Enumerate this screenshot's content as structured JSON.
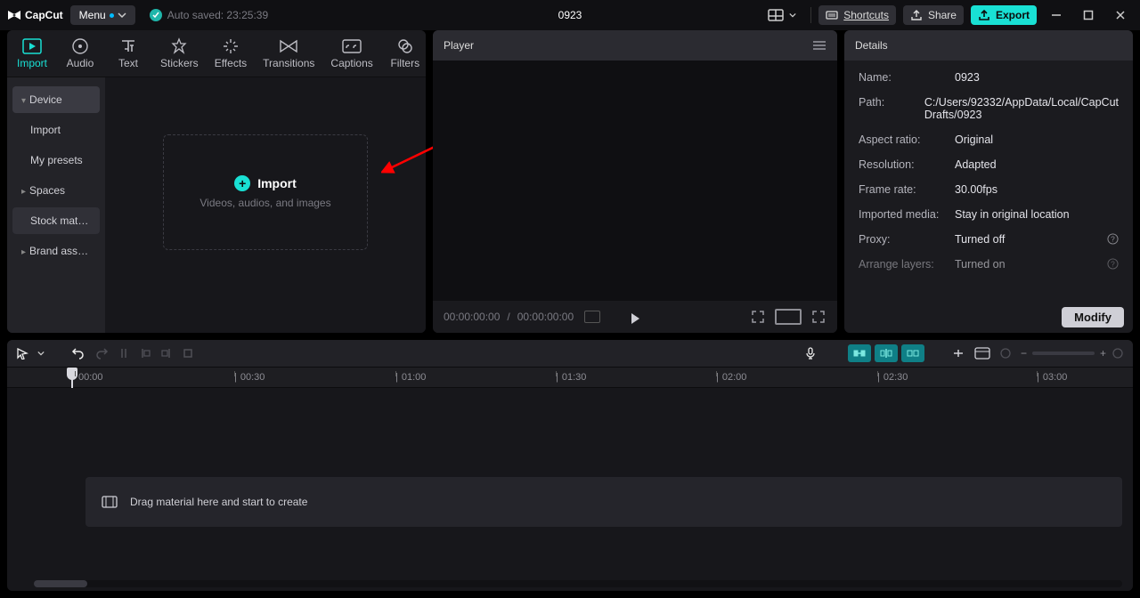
{
  "app": {
    "name": "CapCut"
  },
  "menu": {
    "label": "Menu"
  },
  "autosave": {
    "text": "Auto saved: 23:25:39"
  },
  "project_title": "0923",
  "topbar": {
    "shortcuts": "Shortcuts",
    "share": "Share",
    "export": "Export"
  },
  "tabs": [
    {
      "label": "Import",
      "active": true
    },
    {
      "label": "Audio"
    },
    {
      "label": "Text"
    },
    {
      "label": "Stickers"
    },
    {
      "label": "Effects"
    },
    {
      "label": "Transitions"
    },
    {
      "label": "Captions"
    },
    {
      "label": "Filters"
    }
  ],
  "sidebar": {
    "items": [
      {
        "label": "Device",
        "expandable": true,
        "active": true,
        "open": true
      },
      {
        "label": "Import"
      },
      {
        "label": "My presets"
      },
      {
        "label": "Spaces",
        "expandable": true
      },
      {
        "label": "Stock mate...",
        "selected": true
      },
      {
        "label": "Brand assets",
        "expandable": true
      }
    ]
  },
  "import_zone": {
    "title": "Import",
    "subtitle": "Videos, audios, and images"
  },
  "player": {
    "header": "Player",
    "time_current": "00:00:00:00",
    "time_sep": " / ",
    "time_total": "00:00:00:00"
  },
  "details": {
    "header": "Details",
    "rows": {
      "name_k": "Name:",
      "name_v": "0923",
      "path_k": "Path:",
      "path_v": "C:/Users/92332/AppData/Local/CapCut Drafts/0923",
      "aspect_k": "Aspect ratio:",
      "aspect_v": "Original",
      "res_k": "Resolution:",
      "res_v": "Adapted",
      "fps_k": "Frame rate:",
      "fps_v": "30.00fps",
      "imp_k": "Imported media:",
      "imp_v": "Stay in original location",
      "proxy_k": "Proxy:",
      "proxy_v": "Turned off",
      "layers_k": "Arrange layers:",
      "layers_v": "Turned on"
    },
    "modify": "Modify"
  },
  "timeline": {
    "ticks": [
      "00:00",
      "00:30",
      "01:00",
      "01:30",
      "02:00",
      "02:30",
      "03:00"
    ],
    "hint": "Drag material here and start to create"
  }
}
